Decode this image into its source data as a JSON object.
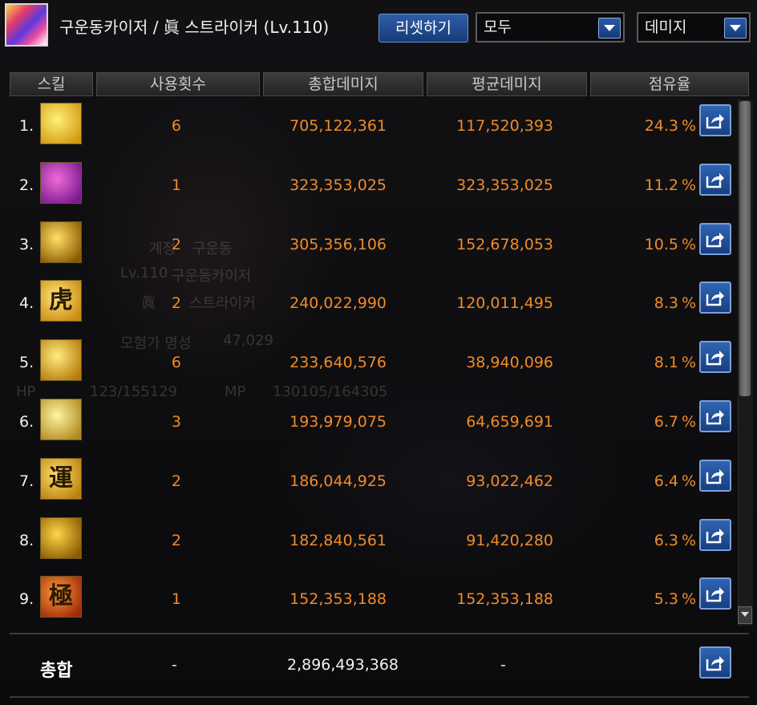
{
  "header": {
    "character_name": "구운동카이저 / 眞 스트라이커 (Lv.110)",
    "reset_label": "리셋하기",
    "filter_value": "모두",
    "metric_value": "데미지"
  },
  "columns": [
    "스킬",
    "사용횟수",
    "총합데미지",
    "평균데미지",
    "점유율"
  ],
  "rows": [
    {
      "rank": "1.",
      "count": "6",
      "total": "705,122,361",
      "avg": "117,520,393",
      "share": "24.3",
      "pct": "%"
    },
    {
      "rank": "2.",
      "count": "1",
      "total": "323,353,025",
      "avg": "323,353,025",
      "share": "11.2",
      "pct": "%"
    },
    {
      "rank": "3.",
      "count": "2",
      "total": "305,356,106",
      "avg": "152,678,053",
      "share": "10.5",
      "pct": "%"
    },
    {
      "rank": "4.",
      "count": "2",
      "total": "240,022,990",
      "avg": "120,011,495",
      "share": "8.3",
      "pct": "%"
    },
    {
      "rank": "5.",
      "count": "6",
      "total": "233,640,576",
      "avg": "38,940,096",
      "share": "8.1",
      "pct": "%"
    },
    {
      "rank": "6.",
      "count": "3",
      "total": "193,979,075",
      "avg": "64,659,691",
      "share": "6.7",
      "pct": "%"
    },
    {
      "rank": "7.",
      "count": "2",
      "total": "186,044,925",
      "avg": "93,022,462",
      "share": "6.4",
      "pct": "%"
    },
    {
      "rank": "8.",
      "count": "2",
      "total": "182,840,561",
      "avg": "91,420,280",
      "share": "6.3",
      "pct": "%"
    },
    {
      "rank": "9.",
      "count": "1",
      "total": "152,353,188",
      "avg": "152,353,188",
      "share": "5.3",
      "pct": "%"
    }
  ],
  "skill_icons": [
    {
      "name": "arrow-strike-icon",
      "glyph": "",
      "c1": "#fff07a",
      "c2": "#d29a10"
    },
    {
      "name": "claw-slash-icon",
      "glyph": "",
      "c1": "#f06ad8",
      "c2": "#7a1a90"
    },
    {
      "name": "lightning-kick-icon",
      "glyph": "",
      "c1": "#ffe066",
      "c2": "#8a5a00"
    },
    {
      "name": "tiger-icon",
      "glyph": "虎",
      "c1": "#ffe77a",
      "c2": "#c98a10"
    },
    {
      "name": "fist-burst-icon",
      "glyph": "",
      "c1": "#ffec80",
      "c2": "#b57a08"
    },
    {
      "name": "radiant-burst-icon",
      "glyph": "",
      "c1": "#fff4a0",
      "c2": "#b08a20"
    },
    {
      "name": "fortune-icon",
      "glyph": "運",
      "c1": "#ffe066",
      "c2": "#b98010"
    },
    {
      "name": "swirl-strike-icon",
      "glyph": "",
      "c1": "#ffd54a",
      "c2": "#8a5a00"
    },
    {
      "name": "extreme-icon",
      "glyph": "極",
      "c1": "#ff9a3a",
      "c2": "#a02a08"
    }
  ],
  "footer": {
    "label": "총합",
    "count": "-",
    "total": "2,896,493,368",
    "avg": "-"
  },
  "background_text": [
    "계정",
    "구운동",
    "Lv.110",
    "구운동카이저",
    "眞",
    "스트라이커",
    "모험가 명성",
    "47,029",
    "HP",
    "123/155129",
    "MP",
    "130105/164305"
  ]
}
